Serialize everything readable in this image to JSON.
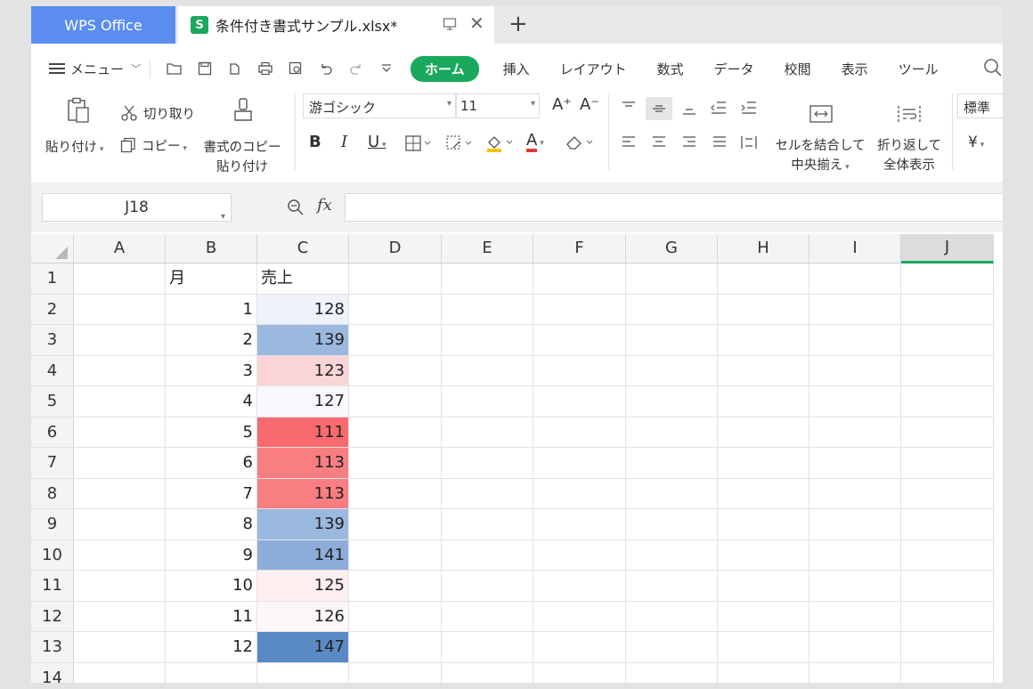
{
  "tabs": {
    "app": "WPS Office",
    "file": "条件付き書式サンプル.xlsx*",
    "file_icon": "S",
    "new_tab": "+",
    "close": "✕"
  },
  "menu": {
    "menu_label": "メニュー",
    "ribbon_tabs": [
      "ホーム",
      "挿入",
      "レイアウト",
      "数式",
      "データ",
      "校閲",
      "表示",
      "ツール"
    ],
    "active_tab": "ホーム"
  },
  "ribbon": {
    "paste": "貼り付け",
    "cut": "切り取り",
    "copy": "コピー",
    "format_painter_1": "書式のコピー",
    "format_painter_2": "貼り付け",
    "font_name": "游ゴシック",
    "font_size": "11",
    "bold": "B",
    "italic": "I",
    "underline": "U",
    "font_color_glyph": "A",
    "grow_font": "A⁺",
    "shrink_font": "A⁻",
    "merge_1": "セルを結合して",
    "merge_2": "中央揃え",
    "wrap_1": "折り返して",
    "wrap_2": "全体表示",
    "number_format": "標準",
    "currency": "¥"
  },
  "formula_bar": {
    "name_box": "J18",
    "fx": "fx",
    "formula": ""
  },
  "sheet": {
    "columns": [
      "A",
      "B",
      "C",
      "D",
      "E",
      "F",
      "G",
      "H",
      "I",
      "J"
    ],
    "selected_column": "J",
    "row_numbers": [
      "1",
      "2",
      "3",
      "4",
      "5",
      "6",
      "7",
      "8",
      "9",
      "10",
      "11",
      "12",
      "13",
      "14"
    ],
    "header_b": "月",
    "header_c": "売上",
    "months": [
      "1",
      "2",
      "3",
      "4",
      "5",
      "6",
      "7",
      "8",
      "9",
      "10",
      "11",
      "12"
    ],
    "sales": [
      "128",
      "139",
      "123",
      "127",
      "111",
      "113",
      "113",
      "139",
      "141",
      "125",
      "126",
      "147"
    ],
    "sales_colors": [
      "#eef3fb",
      "#9bb8df",
      "#fad5d7",
      "#f6f8fc",
      "#f86a6e",
      "#f87e82",
      "#f87e82",
      "#9bb8df",
      "#8eacd9",
      "#fdeef0",
      "#fbf6fa",
      "#5a8ac6"
    ]
  }
}
